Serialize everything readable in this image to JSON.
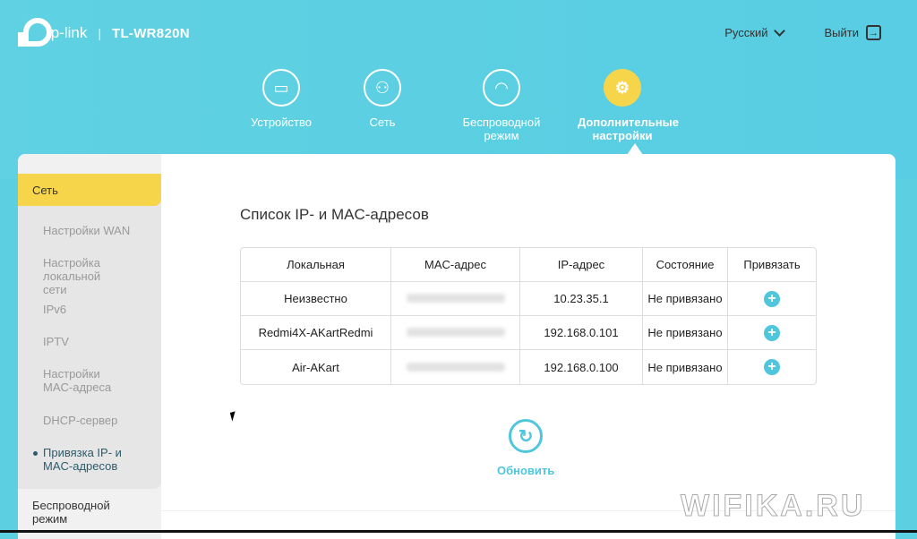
{
  "header": {
    "brand": "tp-link",
    "separator": "|",
    "model": "TL-WR820N",
    "language": "Русский",
    "logout": "Выйти"
  },
  "nav": [
    {
      "label": "Устройство",
      "icon": "monitor-icon",
      "glyph": "▭"
    },
    {
      "label": "Сеть",
      "icon": "network-icon",
      "glyph": "⚇"
    },
    {
      "label": "Беспроводной режим",
      "icon": "wifi-icon",
      "glyph": "◠"
    },
    {
      "label": "Дополнительные настройки",
      "icon": "gear-icon",
      "glyph": "⚙"
    }
  ],
  "sidebar": {
    "group": "Сеть",
    "items": [
      "Настройки WAN",
      "Настройка локальной сети",
      "IPv6",
      "IPTV",
      "Настройки MAC-адреса",
      "DHCP-сервер",
      "Привязка IP- и MAC-адресов"
    ],
    "next": "Беспроводной режим"
  },
  "main": {
    "title": "Список IP- и MAC-адресов",
    "columns": [
      "Локальная",
      "MAC-адрес",
      "IP-адрес",
      "Состояние",
      "Привязать"
    ],
    "rows": [
      {
        "name": "Неизвестно",
        "ip": "10.23.35.1",
        "state": "Не привязано"
      },
      {
        "name": "Redmi4X-AKartRedmi",
        "ip": "192.168.0.101",
        "state": "Не привязано"
      },
      {
        "name": "Air-AKart",
        "ip": "192.168.0.100",
        "state": "Не привязано"
      }
    ],
    "refresh": "Обновить"
  },
  "watermark": "WIFIKA.RU",
  "colors": {
    "header": "#5ccfe1",
    "accent": "#4fc6dc",
    "active": "#f7d54b"
  }
}
